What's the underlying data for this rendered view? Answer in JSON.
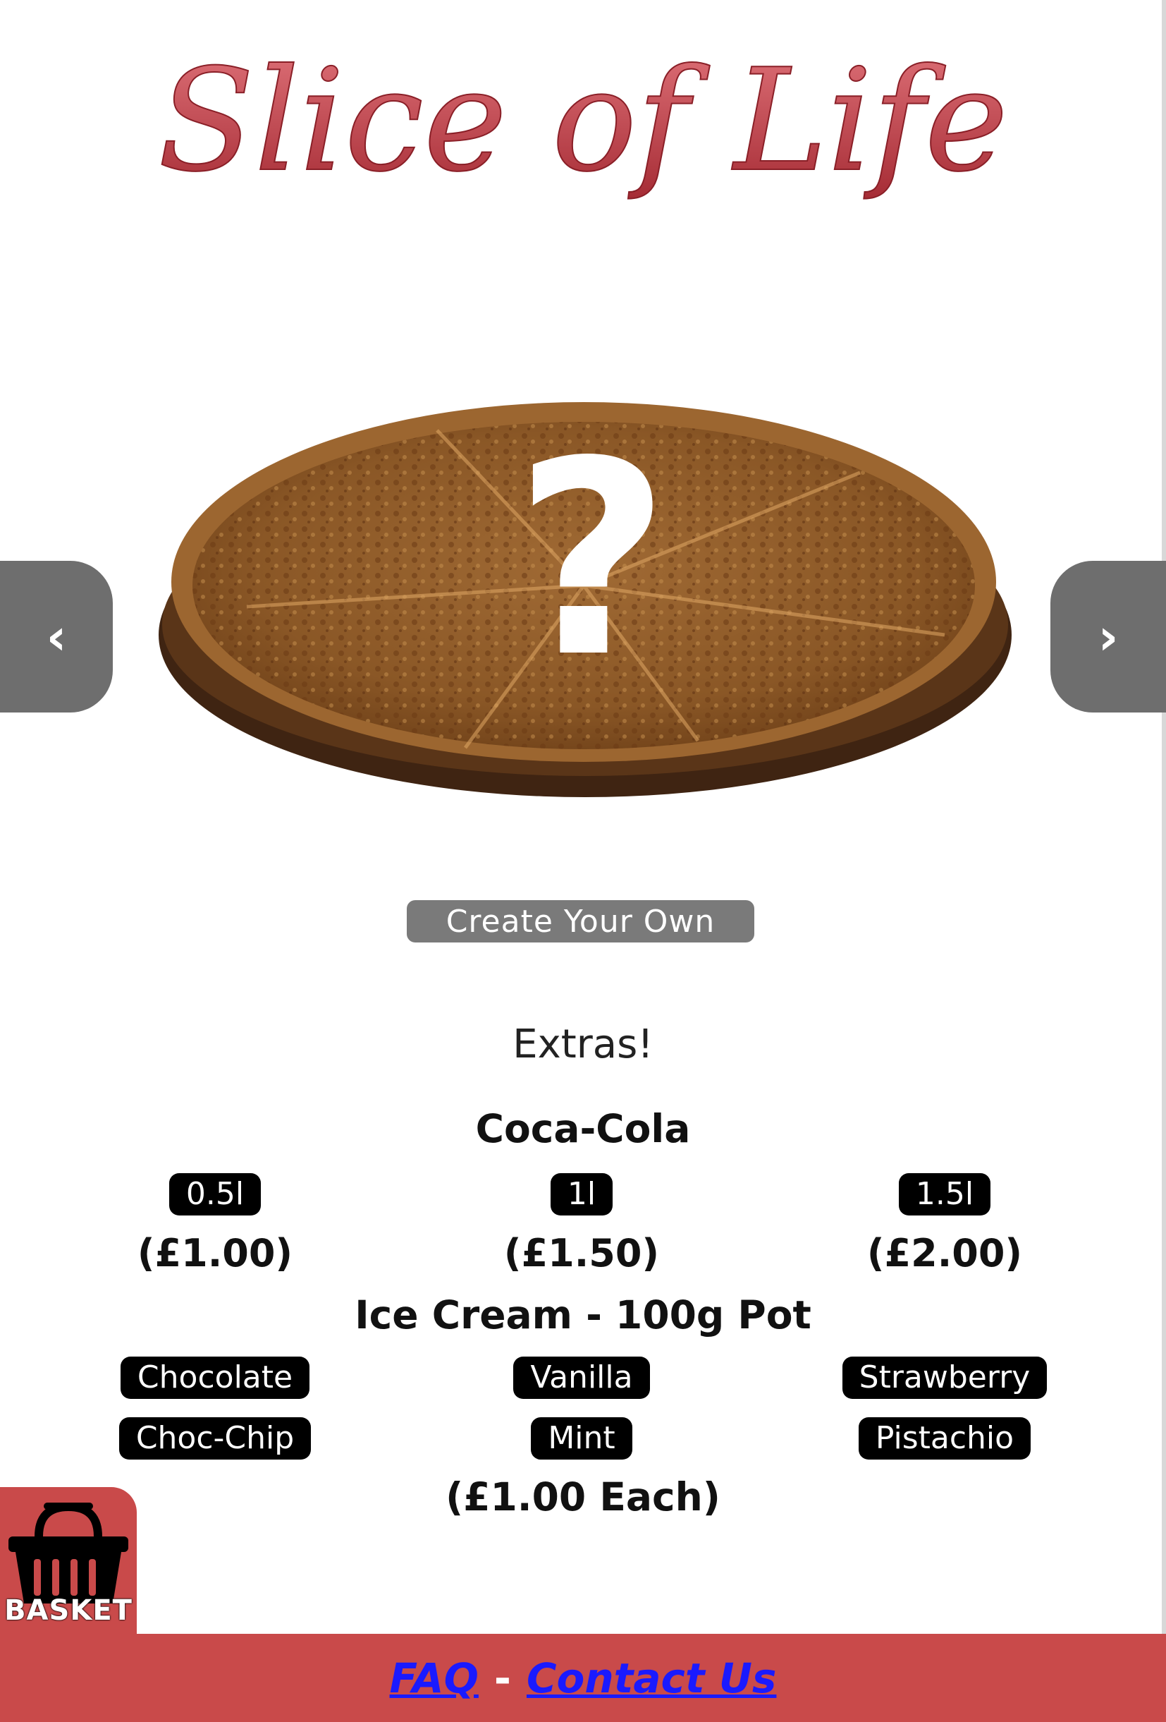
{
  "header": {
    "logo_text": "Slice of Life"
  },
  "carousel": {
    "prev_label": "‹",
    "next_label": "›",
    "overlay_symbol": "?"
  },
  "create_button_label": "Create Your Own",
  "extras": {
    "title": "Extras!",
    "cola": {
      "title": "Coca-Cola",
      "sizes": [
        "0.5l",
        "1l",
        "1.5l"
      ],
      "prices": [
        "(£1.00)",
        "(£1.50)",
        "(£2.00)"
      ]
    },
    "ice_cream": {
      "title": "Ice Cream - 100g Pot",
      "flavours_row1": [
        "Chocolate",
        "Vanilla",
        "Strawberry"
      ],
      "flavours_row2": [
        "Choc-Chip",
        "Mint",
        "Pistachio"
      ],
      "price": "(£1.00 Each)"
    }
  },
  "basket_label": "BASKET",
  "footer": {
    "faq": "FAQ",
    "separator": "-",
    "contact": "Contact Us"
  },
  "colors": {
    "brand_red": "#c94a4a",
    "logo_red": "#b8353e",
    "link_blue": "#1a1aff"
  }
}
